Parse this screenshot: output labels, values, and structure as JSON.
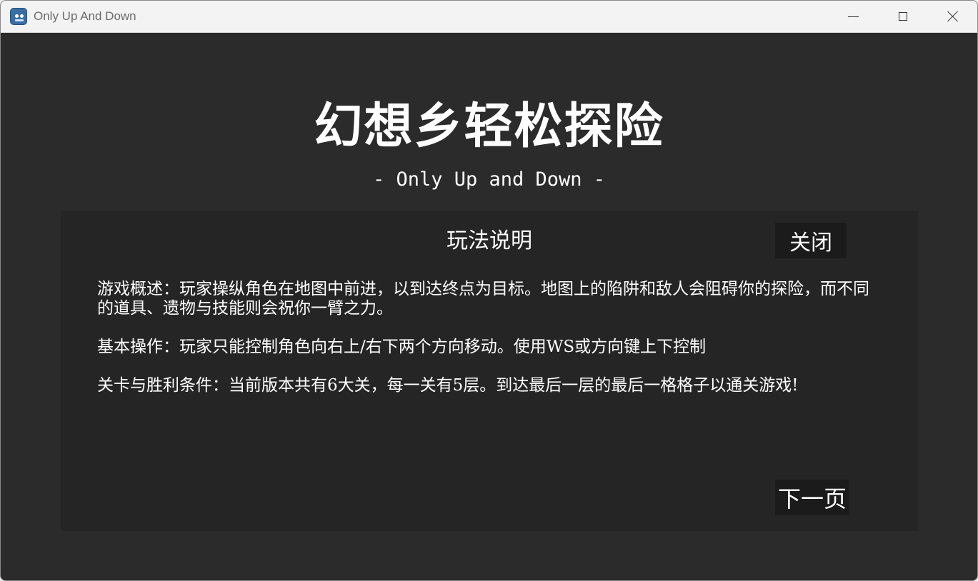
{
  "window": {
    "title": "Only Up And Down",
    "icon": "godot-app-icon",
    "controls": {
      "minimize": "minimize-icon",
      "maximize": "maximize-icon",
      "close": "close-icon"
    }
  },
  "game": {
    "title": "幻想乡轻松探险",
    "subtitle": "- Only Up and Down -"
  },
  "panel": {
    "title": "玩法说明",
    "close_label": "关闭",
    "paragraphs": [
      "游戏概述：玩家操纵角色在地图中前进，以到达终点为目标。地图上的陷阱和敌人会阻碍你的探险，而不同的道具、遗物与技能则会祝你一臂之力。",
      "基本操作：玩家只能控制角色向右上/右下两个方向移动。使用WS或方向键上下控制",
      "关卡与胜利条件：当前版本共有6大关，每一关有5层。到达最后一层的最后一格格子以通关游戏!"
    ],
    "next_label": "下一页"
  },
  "colors": {
    "background": "#2b2b2b",
    "panel": "#252525",
    "button": "#1b1b1b",
    "text": "#ffffff",
    "titlebar": "#f3f3f3"
  }
}
